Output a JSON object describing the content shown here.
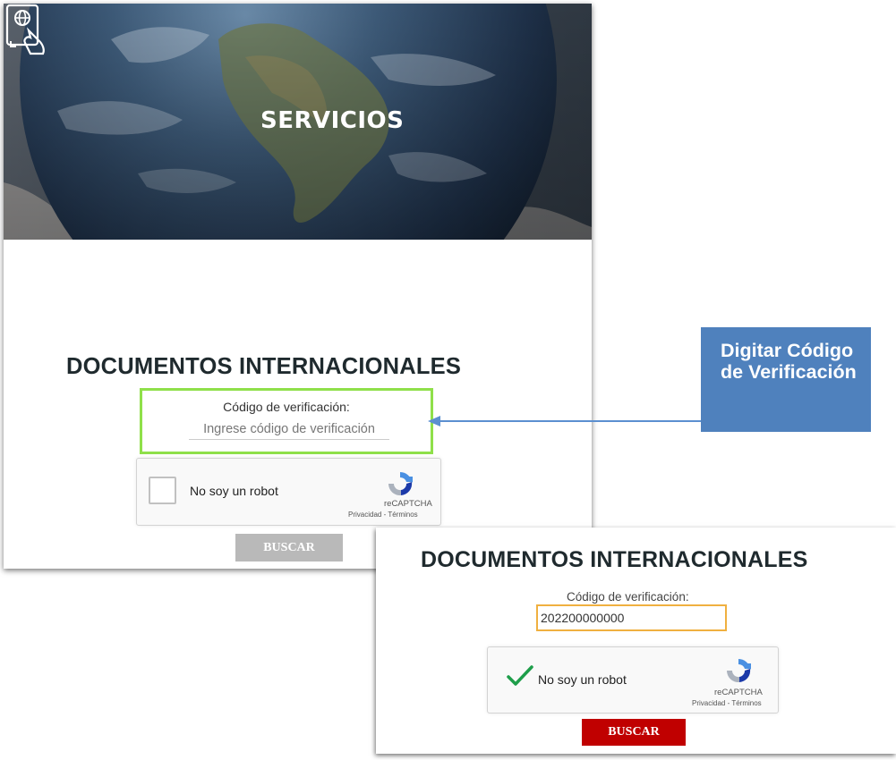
{
  "hero": {
    "title": "SERVICIOS",
    "icon": "passport-icon"
  },
  "form_empty": {
    "title": "DOCUMENTOS INTERNACIONALES",
    "code_label": "Código de verificación:",
    "code_placeholder": "Ingrese código de verificación",
    "captcha_label": "No soy un robot",
    "captcha_brand": "reCAPTCHA",
    "captcha_terms": "Privacidad - Términos",
    "search_label": "BUSCAR",
    "search_color": "#b9b9b9"
  },
  "callout": {
    "text": "Digitar Código de Verificación",
    "color": "#4f81bd"
  },
  "form_filled": {
    "title": "DOCUMENTOS INTERNACIONALES",
    "code_label": "Código de verificación:",
    "code_value": "202200000000",
    "captcha_label": "No soy un robot",
    "captcha_brand": "reCAPTCHA",
    "captcha_terms": "Privacidad - Términos",
    "search_label": "BUSCAR",
    "search_color": "#c00000",
    "highlight_color": "#8fe04a",
    "focus_color": "#f0b040"
  }
}
